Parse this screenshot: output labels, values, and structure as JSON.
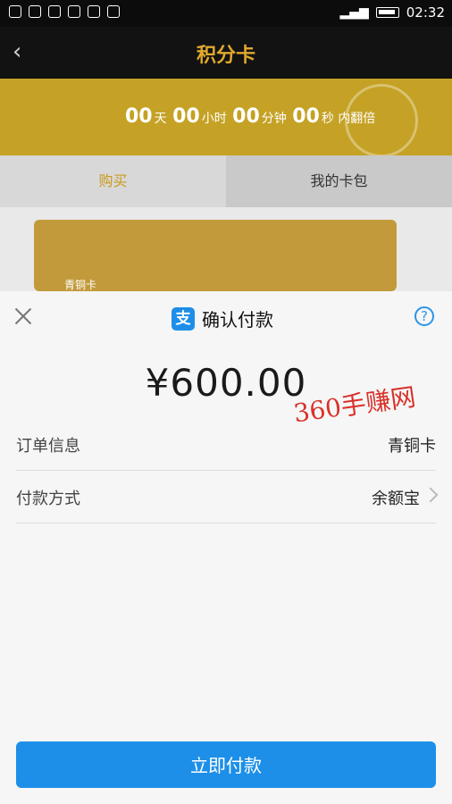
{
  "status_bar": {
    "time": "02:32"
  },
  "header": {
    "title": "积分卡",
    "back_icon": "back-arrow-icon"
  },
  "banner": {
    "days": "00",
    "days_unit": "天",
    "hours": "00",
    "hours_unit": "小时",
    "minutes": "00",
    "minutes_unit": "分钟",
    "seconds": "00",
    "seconds_unit": "秒",
    "suffix": "内翻倍"
  },
  "tabs": {
    "buy": "购买",
    "wallet": "我的卡包"
  },
  "card": {
    "label": "青铜卡"
  },
  "payment_sheet": {
    "title": "确认付款",
    "amount": "¥600.00",
    "watermark": "360手赚网",
    "order_label": "订单信息",
    "order_value": "青铜卡",
    "method_label": "付款方式",
    "method_value": "余额宝",
    "pay_button": "立即付款"
  }
}
